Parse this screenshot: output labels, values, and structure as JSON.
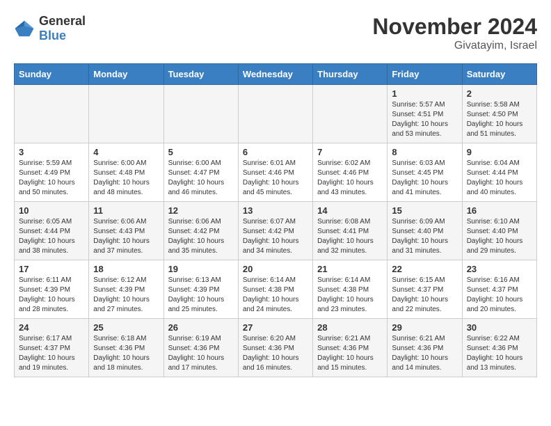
{
  "logo": {
    "general": "General",
    "blue": "Blue"
  },
  "title": "November 2024",
  "location": "Givatayim, Israel",
  "weekdays": [
    "Sunday",
    "Monday",
    "Tuesday",
    "Wednesday",
    "Thursday",
    "Friday",
    "Saturday"
  ],
  "weeks": [
    [
      {
        "day": "",
        "info": ""
      },
      {
        "day": "",
        "info": ""
      },
      {
        "day": "",
        "info": ""
      },
      {
        "day": "",
        "info": ""
      },
      {
        "day": "",
        "info": ""
      },
      {
        "day": "1",
        "info": "Sunrise: 5:57 AM\nSunset: 4:51 PM\nDaylight: 10 hours\nand 53 minutes."
      },
      {
        "day": "2",
        "info": "Sunrise: 5:58 AM\nSunset: 4:50 PM\nDaylight: 10 hours\nand 51 minutes."
      }
    ],
    [
      {
        "day": "3",
        "info": "Sunrise: 5:59 AM\nSunset: 4:49 PM\nDaylight: 10 hours\nand 50 minutes."
      },
      {
        "day": "4",
        "info": "Sunrise: 6:00 AM\nSunset: 4:48 PM\nDaylight: 10 hours\nand 48 minutes."
      },
      {
        "day": "5",
        "info": "Sunrise: 6:00 AM\nSunset: 4:47 PM\nDaylight: 10 hours\nand 46 minutes."
      },
      {
        "day": "6",
        "info": "Sunrise: 6:01 AM\nSunset: 4:46 PM\nDaylight: 10 hours\nand 45 minutes."
      },
      {
        "day": "7",
        "info": "Sunrise: 6:02 AM\nSunset: 4:46 PM\nDaylight: 10 hours\nand 43 minutes."
      },
      {
        "day": "8",
        "info": "Sunrise: 6:03 AM\nSunset: 4:45 PM\nDaylight: 10 hours\nand 41 minutes."
      },
      {
        "day": "9",
        "info": "Sunrise: 6:04 AM\nSunset: 4:44 PM\nDaylight: 10 hours\nand 40 minutes."
      }
    ],
    [
      {
        "day": "10",
        "info": "Sunrise: 6:05 AM\nSunset: 4:44 PM\nDaylight: 10 hours\nand 38 minutes."
      },
      {
        "day": "11",
        "info": "Sunrise: 6:06 AM\nSunset: 4:43 PM\nDaylight: 10 hours\nand 37 minutes."
      },
      {
        "day": "12",
        "info": "Sunrise: 6:06 AM\nSunset: 4:42 PM\nDaylight: 10 hours\nand 35 minutes."
      },
      {
        "day": "13",
        "info": "Sunrise: 6:07 AM\nSunset: 4:42 PM\nDaylight: 10 hours\nand 34 minutes."
      },
      {
        "day": "14",
        "info": "Sunrise: 6:08 AM\nSunset: 4:41 PM\nDaylight: 10 hours\nand 32 minutes."
      },
      {
        "day": "15",
        "info": "Sunrise: 6:09 AM\nSunset: 4:40 PM\nDaylight: 10 hours\nand 31 minutes."
      },
      {
        "day": "16",
        "info": "Sunrise: 6:10 AM\nSunset: 4:40 PM\nDaylight: 10 hours\nand 29 minutes."
      }
    ],
    [
      {
        "day": "17",
        "info": "Sunrise: 6:11 AM\nSunset: 4:39 PM\nDaylight: 10 hours\nand 28 minutes."
      },
      {
        "day": "18",
        "info": "Sunrise: 6:12 AM\nSunset: 4:39 PM\nDaylight: 10 hours\nand 27 minutes."
      },
      {
        "day": "19",
        "info": "Sunrise: 6:13 AM\nSunset: 4:39 PM\nDaylight: 10 hours\nand 25 minutes."
      },
      {
        "day": "20",
        "info": "Sunrise: 6:14 AM\nSunset: 4:38 PM\nDaylight: 10 hours\nand 24 minutes."
      },
      {
        "day": "21",
        "info": "Sunrise: 6:14 AM\nSunset: 4:38 PM\nDaylight: 10 hours\nand 23 minutes."
      },
      {
        "day": "22",
        "info": "Sunrise: 6:15 AM\nSunset: 4:37 PM\nDaylight: 10 hours\nand 22 minutes."
      },
      {
        "day": "23",
        "info": "Sunrise: 6:16 AM\nSunset: 4:37 PM\nDaylight: 10 hours\nand 20 minutes."
      }
    ],
    [
      {
        "day": "24",
        "info": "Sunrise: 6:17 AM\nSunset: 4:37 PM\nDaylight: 10 hours\nand 19 minutes."
      },
      {
        "day": "25",
        "info": "Sunrise: 6:18 AM\nSunset: 4:36 PM\nDaylight: 10 hours\nand 18 minutes."
      },
      {
        "day": "26",
        "info": "Sunrise: 6:19 AM\nSunset: 4:36 PM\nDaylight: 10 hours\nand 17 minutes."
      },
      {
        "day": "27",
        "info": "Sunrise: 6:20 AM\nSunset: 4:36 PM\nDaylight: 10 hours\nand 16 minutes."
      },
      {
        "day": "28",
        "info": "Sunrise: 6:21 AM\nSunset: 4:36 PM\nDaylight: 10 hours\nand 15 minutes."
      },
      {
        "day": "29",
        "info": "Sunrise: 6:21 AM\nSunset: 4:36 PM\nDaylight: 10 hours\nand 14 minutes."
      },
      {
        "day": "30",
        "info": "Sunrise: 6:22 AM\nSunset: 4:36 PM\nDaylight: 10 hours\nand 13 minutes."
      }
    ]
  ]
}
